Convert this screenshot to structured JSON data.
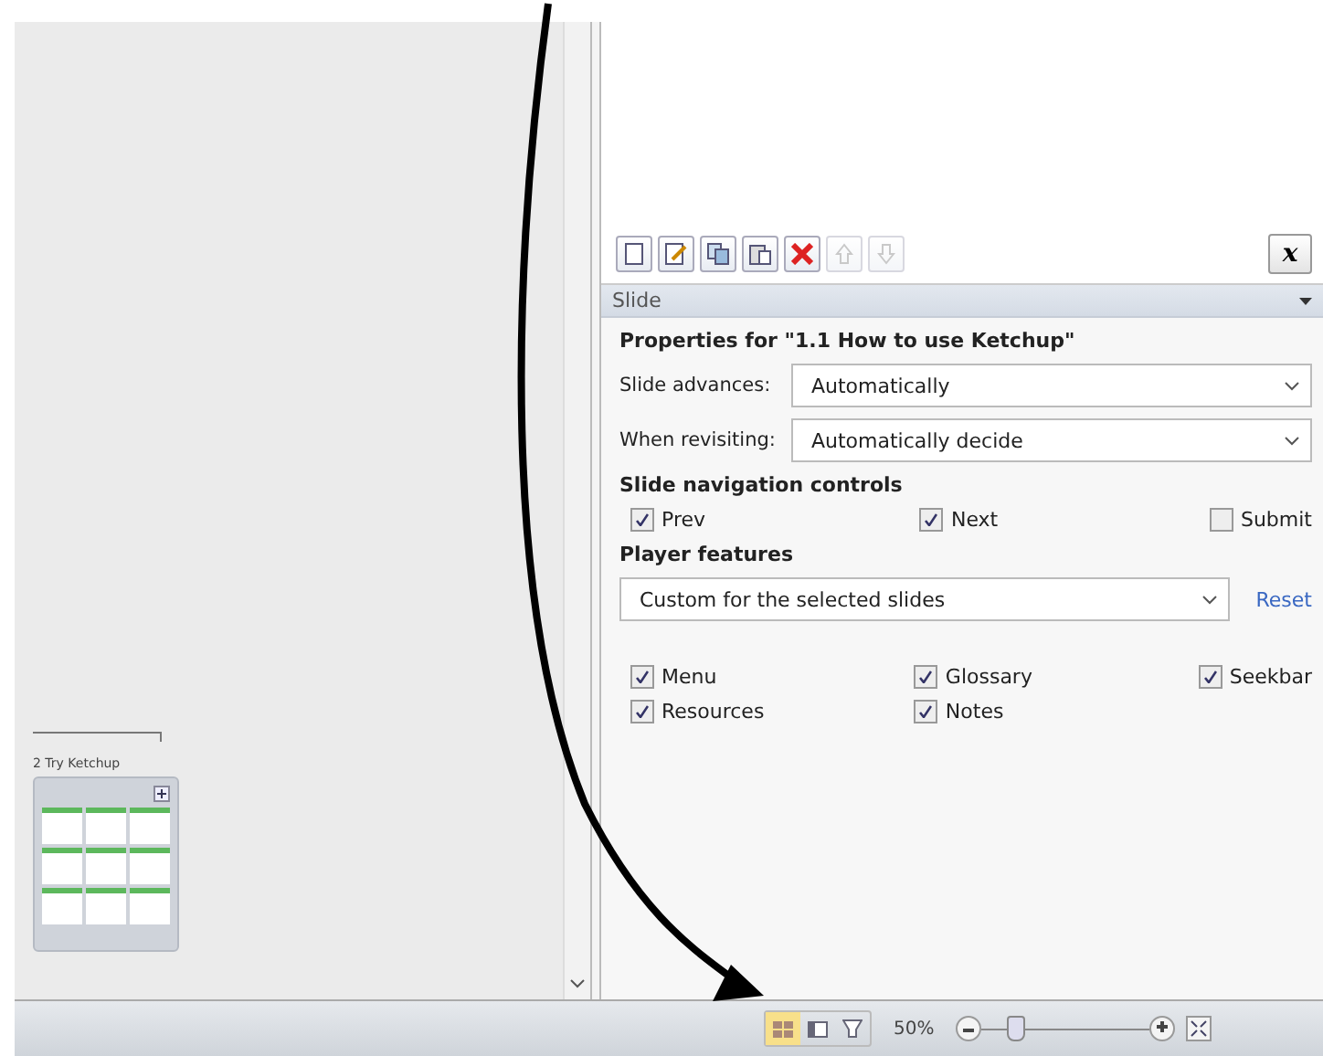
{
  "canvas": {
    "scene": {
      "title": "2 Try Ketchup"
    }
  },
  "toolbar": {
    "buttons": [
      {
        "kind": "new",
        "disabled": false
      },
      {
        "kind": "edit",
        "disabled": false
      },
      {
        "kind": "copy",
        "disabled": false
      },
      {
        "kind": "paste",
        "disabled": false
      },
      {
        "kind": "delete",
        "disabled": false
      },
      {
        "kind": "up",
        "disabled": true
      },
      {
        "kind": "down",
        "disabled": true
      }
    ],
    "variable_button": "x"
  },
  "panel": {
    "header": "Slide",
    "heading": "Properties for \"1.1 How to use Ketchup\"",
    "fields": [
      {
        "label": "Slide advances:",
        "value": "Automatically"
      },
      {
        "label": "When revisiting:",
        "value": "Automatically decide"
      }
    ],
    "nav_title": "Slide navigation controls",
    "nav_controls": [
      {
        "label": "Prev",
        "checked": true
      },
      {
        "label": "Next",
        "checked": true
      },
      {
        "label": "Submit",
        "checked": false
      }
    ],
    "features_title": "Player features",
    "features_select": "Custom for the selected slides",
    "reset": "Reset",
    "features": [
      {
        "label": "Menu",
        "checked": true
      },
      {
        "label": "Glossary",
        "checked": true
      },
      {
        "label": "Seekbar",
        "checked": true
      },
      {
        "label": "Resources",
        "checked": true
      },
      {
        "label": "Notes",
        "checked": true
      }
    ]
  },
  "status_bar": {
    "views": [
      {
        "kind": "story",
        "selected": true
      },
      {
        "kind": "normal",
        "selected": false
      },
      {
        "kind": "preview",
        "selected": false
      }
    ],
    "zoom": "50%",
    "zoom_slider": {
      "level": 0.2
    }
  }
}
